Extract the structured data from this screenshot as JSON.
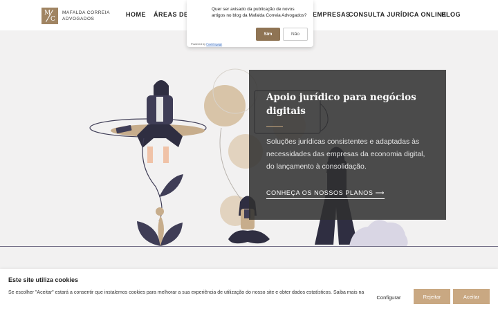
{
  "header": {
    "logo_mark": "M/C",
    "logo_line1": "MAFALDA CORREIA",
    "logo_line2": "ADVOGADOS",
    "nav": [
      "HOME",
      "ÁREAS DE P",
      "EMPRESAS",
      "CONSULTA JURÍDICA ONLINE",
      "BLOG"
    ]
  },
  "push": {
    "message": "Quer ser avisado da publicação de novos artigos no blog da Mafalda Correia Advogados?",
    "yes_label": "Sim",
    "no_label": "Não",
    "powered_prefix": "Powered by",
    "powered_brand": "PushEngage"
  },
  "hero": {
    "title": "Apoio jurídico para negócios digitais",
    "description": "Soluções jurídicas consistentes e adaptadas às necessidades das empresas da economia digital, do lançamento à consolidação.",
    "cta": "CONHEÇA OS NOSSOS PLANOS ⟶"
  },
  "cookies": {
    "title": "Este site utiliza cookies",
    "text": "Se escolher \"Aceitar\" estará a consentir que instalemos cookies para melhorar a sua experiência de utilização do nosso site e obter dados estatísticos. Saiba mais na",
    "configure_label": "Configurar",
    "reject_label": "Rejeitar",
    "accept_label": "Aceitar"
  },
  "colors": {
    "accent": "#c9a882",
    "accent_dark": "#8f7454",
    "illustration_dark": "#3f3d56",
    "illustration_tan": "#d8c4a8"
  }
}
